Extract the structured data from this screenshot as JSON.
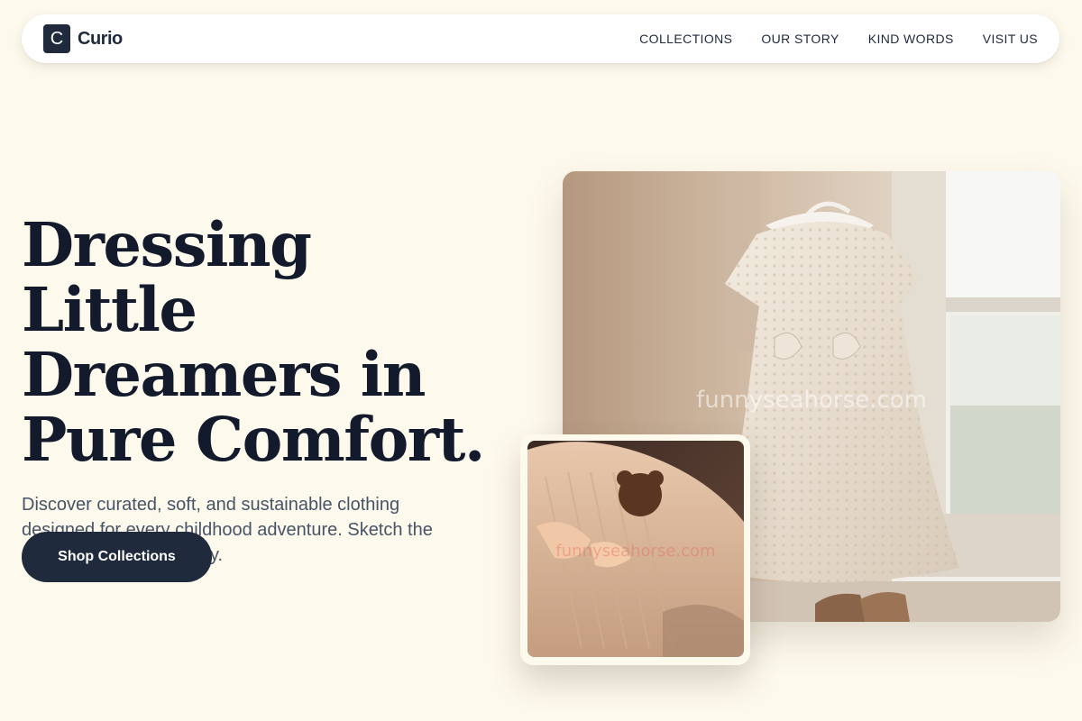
{
  "nav": {
    "logo_letter": "C",
    "brand_name": "Curio",
    "links": [
      "COLLECTIONS",
      "OUR STORY",
      "KIND WORDS",
      "VISIT US"
    ]
  },
  "hero": {
    "headline_lines": [
      "Dressing Little",
      "Dreamers in",
      "Pure Comfort."
    ],
    "subcopy": "Discover curated, soft, and sustainable clothing designed for every childhood adventure. Sketch the Seahorse, Spark the Joy.",
    "cta_label": "Shop Collections"
  },
  "images": {
    "main_watermark": "funnyseahorse.com",
    "inset_watermark": "funnyseahorse.com"
  },
  "colors": {
    "background": "#fdf9ec",
    "primary": "#1f2a3c",
    "headline": "#121a2b",
    "body_text": "#475467"
  }
}
